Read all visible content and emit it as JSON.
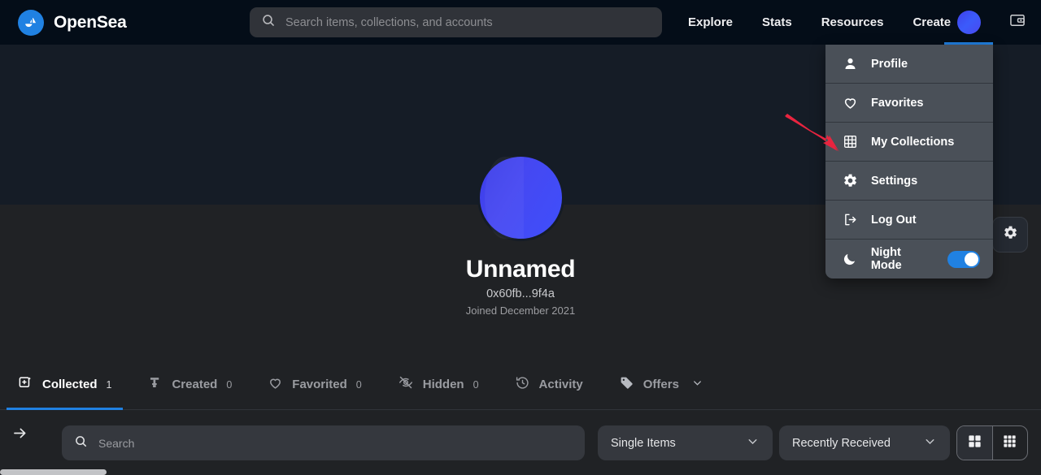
{
  "header": {
    "brand_name": "OpenSea",
    "brand_logo_icon": "opensea-sailboat-logo",
    "search": {
      "placeholder": "Search items, collections, and accounts",
      "value": "",
      "icon": "search-icon"
    },
    "nav_items": [
      {
        "label": "Explore"
      },
      {
        "label": "Stats"
      },
      {
        "label": "Resources"
      },
      {
        "label": "Create"
      }
    ],
    "avatar_icon": "user-avatar",
    "wallet_icon": "wallet-icon"
  },
  "dropdown": {
    "items": [
      {
        "label": "Profile",
        "icon": "person-icon"
      },
      {
        "label": "Favorites",
        "icon": "heart-icon"
      },
      {
        "label": "My Collections",
        "icon": "grid-icon"
      },
      {
        "label": "Settings",
        "icon": "gear-icon"
      },
      {
        "label": "Log Out",
        "icon": "logout-icon"
      },
      {
        "label": "Night Mode",
        "icon": "moon-icon",
        "toggle": true,
        "toggle_on": true
      }
    ]
  },
  "profile": {
    "name": "Unnamed",
    "address": "0x60fb...9f4a",
    "joined": "Joined December 2021",
    "avatar_icon": "profile-avatar",
    "settings_icon": "gear-icon"
  },
  "tabs": [
    {
      "label": "Collected",
      "count": "1",
      "icon": "collected-card-icon",
      "active": true
    },
    {
      "label": "Created",
      "count": "0",
      "icon": "created-stamp-icon",
      "active": false
    },
    {
      "label": "Favorited",
      "count": "0",
      "icon": "heart-icon",
      "active": false
    },
    {
      "label": "Hidden",
      "count": "0",
      "icon": "eye-off-icon",
      "active": false
    },
    {
      "label": "Activity",
      "count": "",
      "icon": "history-clock-icon",
      "active": false
    },
    {
      "label": "Offers",
      "count": "",
      "icon": "tag-icon",
      "active": false,
      "chevron": true
    }
  ],
  "filterbar": {
    "expand_icon": "arrow-right-icon",
    "search": {
      "placeholder": "Search",
      "value": "",
      "icon": "search-icon"
    },
    "type_filter": {
      "value": "Single Items",
      "chevron_icon": "chevron-down-icon"
    },
    "sort_filter": {
      "value": "Recently Received",
      "chevron_icon": "chevron-down-icon"
    },
    "view_toggle": {
      "large_grid_icon": "grid-4-icon",
      "small_grid_icon": "grid-9-icon",
      "active": "large"
    }
  },
  "annotation": {
    "arrow_icon": "red-arrow-pointer",
    "arrow_color": "#e8243f",
    "points_to": "My Collections"
  },
  "colors": {
    "header_bg": "#040d18",
    "banner_bg": "#151c26",
    "page_bg": "#202225",
    "accent_blue": "#2081e2",
    "dropdown_bg": "#4a5058",
    "input_bg": "#35383e",
    "muted_text": "#9a9ca1"
  }
}
